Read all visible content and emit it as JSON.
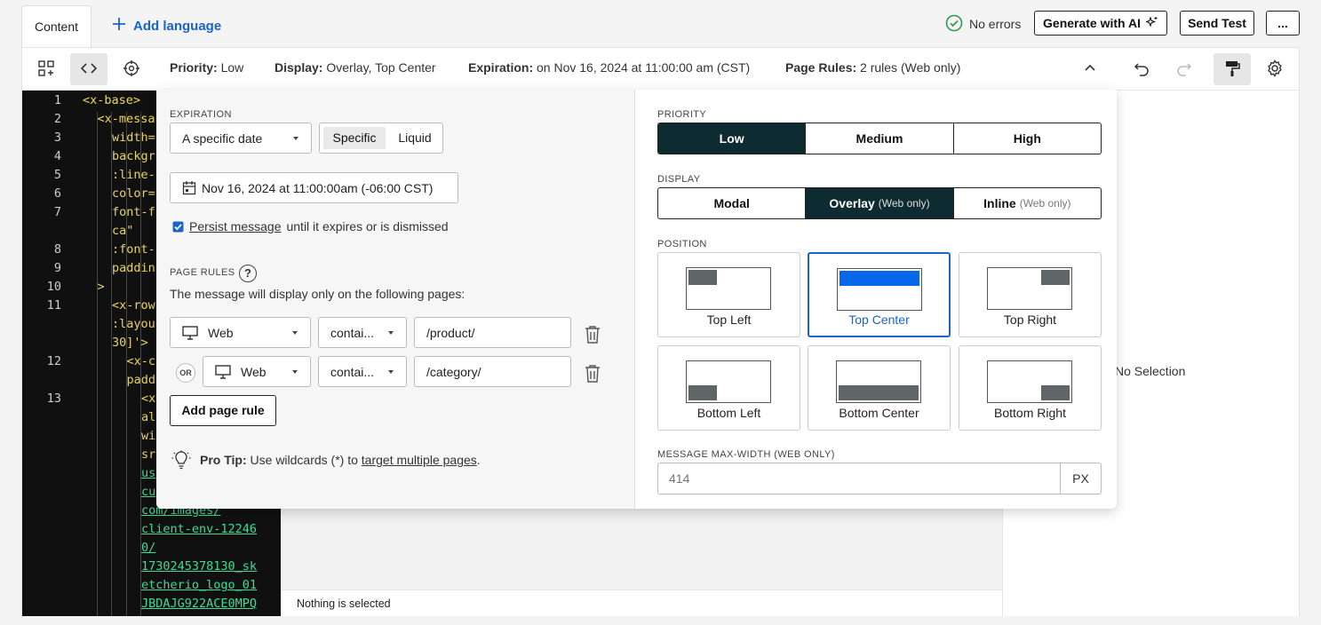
{
  "header": {
    "tab_content": "Content",
    "add_language": "Add language",
    "no_errors": "No errors",
    "generate_ai": "Generate with AI",
    "send_test": "Send Test",
    "more": "..."
  },
  "summary": {
    "priority_label": "Priority:",
    "priority_value": "Low",
    "display_label": "Display:",
    "display_value": "Overlay, Top Center",
    "expiration_label": "Expiration:",
    "expiration_value": "on Nov 16, 2024 at 11:00:00 am (CST)",
    "page_rules_label": "Page Rules:",
    "page_rules_value": "2 rules (Web only)"
  },
  "code": {
    "lines": [
      {
        "n": "1",
        "text": "<x-base>"
      },
      {
        "n": "2",
        "text": "<x-messa"
      },
      {
        "n": "3",
        "text": "width="
      },
      {
        "n": "4",
        "text": "backgr"
      },
      {
        "n": "5",
        "text": ":line-"
      },
      {
        "n": "6",
        "text": "color="
      },
      {
        "n": "7",
        "text": "font-f"
      },
      {
        "n": "",
        "text": "ca\""
      },
      {
        "n": "8",
        "text": ":font-"
      },
      {
        "n": "9",
        "text": "paddin"
      },
      {
        "n": "10",
        "text": ">"
      },
      {
        "n": "11",
        "text": "<x-row"
      },
      {
        "n": "",
        "text": ":layou"
      },
      {
        "n": "",
        "text": "30]'>"
      },
      {
        "n": "12",
        "text": "<x-c"
      },
      {
        "n": "",
        "text": "padd"
      },
      {
        "n": "13",
        "text": "<x"
      },
      {
        "n": "",
        "text": "al"
      },
      {
        "n": "",
        "text": "wi"
      },
      {
        "n": "",
        "text": "sr"
      },
      {
        "n": "",
        "text": "us"
      },
      {
        "n": "",
        "text": "cu"
      },
      {
        "n": "",
        "text": "com/images/"
      },
      {
        "n": "",
        "text": "client-env-12246"
      },
      {
        "n": "",
        "text": "0/"
      },
      {
        "n": "",
        "text": "1730245378130_sk"
      },
      {
        "n": "",
        "text": "etcherio_logo_01"
      },
      {
        "n": "",
        "text": "JBDAJG922ACE0MPQ"
      }
    ]
  },
  "canvas": {
    "status": "Nothing is selected"
  },
  "right_panel": {
    "empty": "No Selection"
  },
  "expiration": {
    "label": "EXPIRATION",
    "mode_select": "A specific date",
    "toggle_specific": "Specific",
    "toggle_liquid": "Liquid",
    "date_value": "Nov 16, 2024 at 11:00:00am (-06:00 CST)",
    "persist_link": "Persist message",
    "persist_rest": "until it expires or is dismissed",
    "persist_checked": true
  },
  "page_rules": {
    "label": "PAGE RULES",
    "help": "?",
    "description": "The message will display only on the following pages:",
    "or_label": "OR",
    "rules": [
      {
        "channel": "Web",
        "operator": "contai...",
        "value": "/product/"
      },
      {
        "channel": "Web",
        "operator": "contai...",
        "value": "/category/"
      }
    ],
    "add_button": "Add page rule"
  },
  "tip": {
    "title": "Pro Tip:",
    "text": "Use wildcards (*) to",
    "link": "target multiple pages",
    "end": "."
  },
  "priority": {
    "label": "PRIORITY",
    "options": [
      "Low",
      "Medium",
      "High"
    ],
    "selected": "Low"
  },
  "display": {
    "label": "DISPLAY",
    "modal": "Modal",
    "overlay": "Overlay",
    "inline": "Inline",
    "web_only": "(Web only)",
    "selected": "Overlay"
  },
  "position": {
    "label": "POSITION",
    "options": [
      "Top Left",
      "Top Center",
      "Top Right",
      "Bottom Left",
      "Bottom Center",
      "Bottom Right"
    ],
    "selected": "Top Center"
  },
  "max_width": {
    "label": "MESSAGE MAX-WIDTH (WEB ONLY)",
    "placeholder": "414",
    "unit": "PX"
  },
  "colors": {
    "accent": "#1a64c8",
    "dark": "#0d2b30",
    "success": "#2e9a4e"
  }
}
